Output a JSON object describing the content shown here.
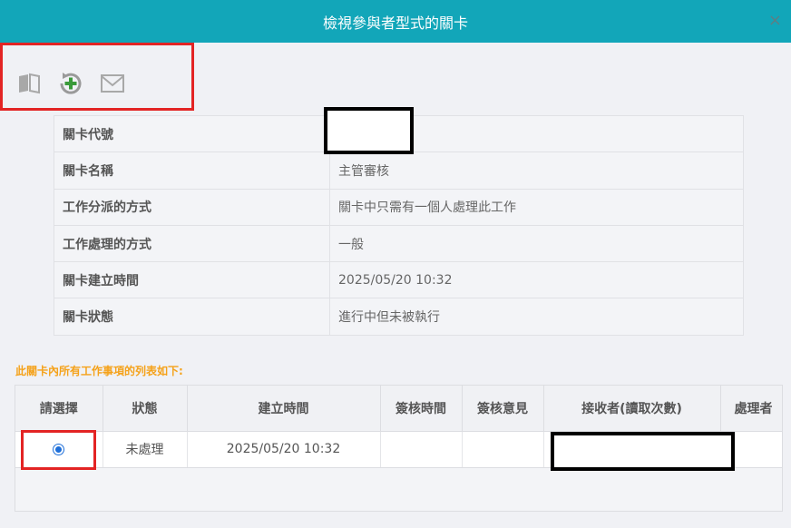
{
  "dialog": {
    "title": "檢視參與者型式的關卡",
    "close_glyph": "×"
  },
  "toolbar": {
    "icons": [
      "book-icon",
      "refresh-add-icon",
      "mail-icon"
    ],
    "colors": {
      "icon_gray": "#9a9a9a",
      "add_green": "#3a9a3a",
      "highlight_red": "#e32424"
    }
  },
  "stage_info": {
    "rows": [
      {
        "label": "關卡代號",
        "value": ""
      },
      {
        "label": "關卡名稱",
        "value": "主管審核"
      },
      {
        "label": "工作分派的方式",
        "value": "關卡中只需有一個人處理此工作"
      },
      {
        "label": "工作處理的方式",
        "value": "一般"
      },
      {
        "label": "關卡建立時間",
        "value": "2025/05/20 10:32"
      },
      {
        "label": "關卡狀態",
        "value": "進行中但未被執行"
      }
    ]
  },
  "work_list": {
    "caption": "此關卡內所有工作事項的列表如下:",
    "columns": [
      "請選擇",
      "狀態",
      "建立時間",
      "簽核時間",
      "簽核意見",
      "接收者(讀取次數)",
      "處理者"
    ],
    "rows": [
      {
        "selected": true,
        "status": "未處理",
        "created": "2025/05/20 10:32",
        "signed_time": "",
        "sign_comment": "",
        "receiver": "",
        "handler": ""
      }
    ]
  },
  "colors": {
    "title_bar": "#12a6b9",
    "caption": "#f5a21a",
    "radio": "#1e6fd9"
  }
}
